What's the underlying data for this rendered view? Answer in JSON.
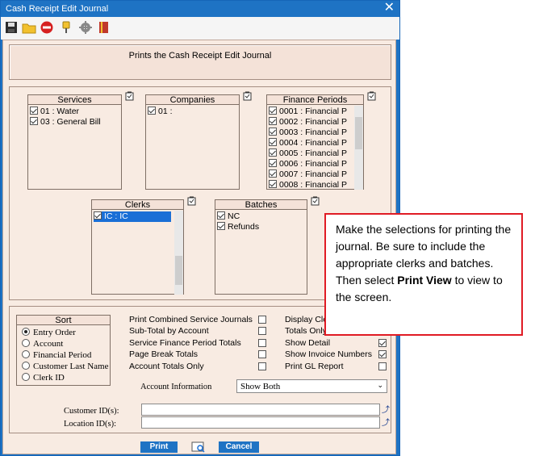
{
  "window": {
    "title": "Cash Receipt Edit Journal",
    "close": "✕"
  },
  "toolbar": {
    "icons": [
      "save-icon",
      "folder-icon",
      "stop-icon",
      "pin-icon",
      "gear-icon",
      "book-icon"
    ]
  },
  "description": "Prints the Cash Receipt Edit Journal",
  "services": {
    "title": "Services",
    "items": [
      {
        "label": "01 : Water",
        "checked": true
      },
      {
        "label": "03 : General Bill",
        "checked": true
      }
    ]
  },
  "companies": {
    "title": "Companies",
    "items": [
      {
        "label": "01 :",
        "checked": true
      }
    ]
  },
  "finance_periods": {
    "title": "Finance Periods",
    "items": [
      {
        "label": "0001 : Financial P",
        "checked": true
      },
      {
        "label": "0002 : Financial P",
        "checked": true
      },
      {
        "label": "0003 : Financial P",
        "checked": true
      },
      {
        "label": "0004 : Financial P",
        "checked": true
      },
      {
        "label": "0005 : Financial P",
        "checked": true
      },
      {
        "label": "0006 : Financial P",
        "checked": true
      },
      {
        "label": "0007 : Financial P",
        "checked": true
      },
      {
        "label": "0008 : Financial P",
        "checked": true
      }
    ]
  },
  "clerks": {
    "title": "Clerks",
    "items": [
      {
        "label": "IC    : IC",
        "checked": true,
        "selected": true
      }
    ]
  },
  "batches": {
    "title": "Batches",
    "items": [
      {
        "label": "NC",
        "checked": true
      },
      {
        "label": "Refunds",
        "checked": true
      }
    ]
  },
  "sort": {
    "title": "Sort",
    "options": [
      "Entry Order",
      "Account",
      "Financial Period",
      "Customer Last Name",
      "Clerk ID"
    ],
    "selected": 0
  },
  "options_left": [
    {
      "label": "Print Combined Service Journals",
      "checked": false
    },
    {
      "label": "Sub-Total by Account",
      "checked": false
    },
    {
      "label": "Service Finance Period Totals",
      "checked": false
    },
    {
      "label": "Page Break Totals",
      "checked": false
    },
    {
      "label": "Account Totals Only",
      "checked": false
    }
  ],
  "options_right": [
    {
      "label": "Display Cle",
      "checked": false
    },
    {
      "label": "Totals Only",
      "checked": false
    },
    {
      "label": "Show Detail",
      "checked": true
    },
    {
      "label": "Show Invoice Numbers",
      "checked": true
    },
    {
      "label": "Print GL Report",
      "checked": false
    }
  ],
  "account_information": {
    "label": "Account Information",
    "value": "Show Both"
  },
  "customer_ids": {
    "label": "Customer ID(s):",
    "value": ""
  },
  "location_ids": {
    "label": "Location ID(s):",
    "value": ""
  },
  "buttons": {
    "print": "Print",
    "cancel": "Cancel"
  },
  "callout": {
    "line1": "Make the selections for printing the journal.  Be sure to include the appropriate clerks and batches.",
    "line2_pre": "Then select ",
    "line2_bold": "Print View",
    "line2_post": " to view to the screen."
  }
}
